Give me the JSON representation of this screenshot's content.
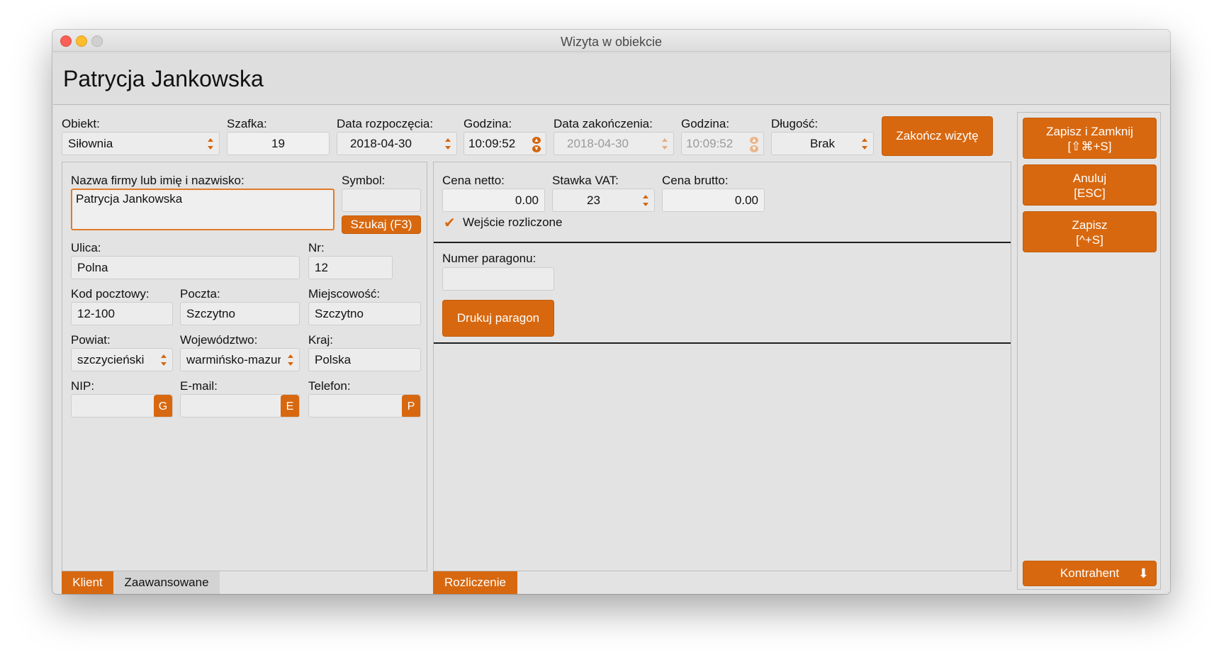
{
  "window": {
    "title": "Wizyta w obiekcie"
  },
  "header": {
    "name": "Patrycja Jankowska"
  },
  "top": {
    "obiekt_label": "Obiekt:",
    "obiekt_value": "Siłownia",
    "szafka_label": "Szafka:",
    "szafka_value": "19",
    "start_date_label": "Data rozpoczęcia:",
    "start_date_value": "2018-04-30",
    "start_time_label": "Godzina:",
    "start_time_value": "10:09:52",
    "end_date_label": "Data zakończenia:",
    "end_date_value": "2018-04-30",
    "end_time_label": "Godzina:",
    "end_time_value": "10:09:52",
    "length_label": "Długość:",
    "length_value": "Brak",
    "finish_button": "Zakończ wizytę"
  },
  "client": {
    "name_label": "Nazwa firmy lub imię i nazwisko:",
    "name_value": "Patrycja Jankowska",
    "symbol_label": "Symbol:",
    "symbol_value": "",
    "search_button": "Szukaj (F3)",
    "street_label": "Ulica:",
    "street_value": "Polna",
    "nr_label": "Nr:",
    "nr_value": "12",
    "zip_label": "Kod pocztowy:",
    "zip_value": "12-100",
    "post_label": "Poczta:",
    "post_value": "Szczytno",
    "city_label": "Miejscowość:",
    "city_value": "Szczytno",
    "county_label": "Powiat:",
    "county_value": "szczycieński",
    "province_label": "Województwo:",
    "province_value": "warmińsko-mazurskie",
    "country_label": "Kraj:",
    "country_value": "Polska",
    "nip_label": "NIP:",
    "nip_value": "",
    "nip_badge": "G",
    "email_label": "E-mail:",
    "email_value": "",
    "email_badge": "E",
    "phone_label": "Telefon:",
    "phone_value": "",
    "phone_badge": "P"
  },
  "left_tabs": [
    {
      "label": "Klient"
    },
    {
      "label": "Zaawansowane"
    }
  ],
  "billing": {
    "net_label": "Cena netto:",
    "net_value": "0.00",
    "vat_label": "Stawka VAT:",
    "vat_value": "23",
    "gross_label": "Cena brutto:",
    "gross_value": "0.00",
    "settled_label": "Wejście rozliczone",
    "receipt_label": "Numer paragonu:",
    "receipt_value": "",
    "print_button": "Drukuj paragon"
  },
  "right_tabs": [
    {
      "label": "Rozliczenie"
    }
  ],
  "actions": {
    "save_close_line1": "Zapisz i Zamknij",
    "save_close_line2": "[⇧⌘+S]",
    "cancel_line1": "Anuluj",
    "cancel_line2": "[ESC]",
    "save_line1": "Zapisz",
    "save_line2": "[^+S]",
    "contractor": "Kontrahent"
  },
  "colors": {
    "accent": "#d8680f",
    "window_bg": "#e3e3e3"
  }
}
